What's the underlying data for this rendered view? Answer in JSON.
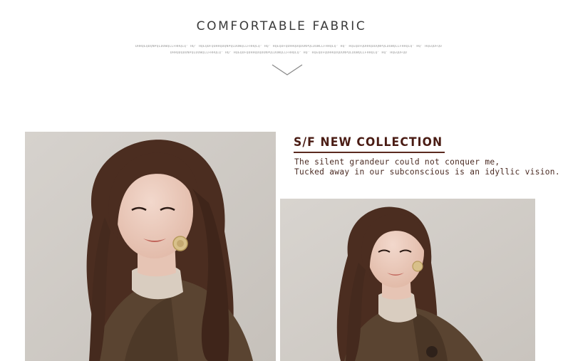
{
  "header": {
    "title": "COMFORTABLE FABRIC",
    "fine_text_1": "DHHQEQDQNPQLDOWQLLFHHQLQ' HQ' HQEQDFQOHHQDQNPQLDOWQLLFHHQLQ' HQ' HQEQDFQDHHQDQDONPQLDOWLLFHHQLQ' HQ' HQEQDFQDHHQDDQNPQLDOWQLLFHHQLQ' HQ' HQEQDFQO",
    "fine_text_2": "DHHQDQDONPQLDOWQLLFHHQLQ' HQ' HQEQDFQDHHQDQDONPQLDOWQLLFHHQLQ' HQ' HQEQDFQDHHQDQDONPQLDOWQLLFHHQLQ' HQ' HQEQDFQD"
  },
  "collection": {
    "heading": "S/F NEW COLLECTION",
    "line_1": "The silent grandeur could not conquer me,",
    "line_2": "Tucked away in our subconscious is an idyllic vision."
  },
  "icons": {
    "chevron": "chevron-down-icon",
    "earring": "earring-icon",
    "button": "coat-button-icon"
  },
  "colors": {
    "title": "#3a3a3a",
    "heading": "#4a1c14",
    "rule": "#5a2a1f",
    "backdrop": "#cfcbc6",
    "coat": "#5b4532",
    "hair": "#4e3022"
  }
}
